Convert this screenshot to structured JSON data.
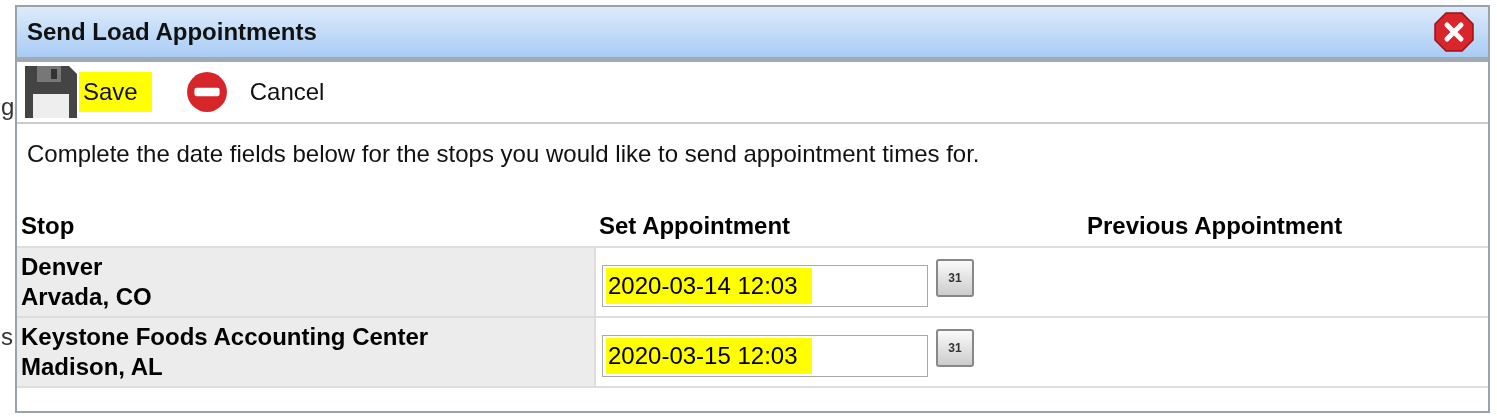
{
  "background": {
    "fragments": [
      "g",
      "s"
    ]
  },
  "dialog": {
    "title": "Send Load Appointments",
    "toolbar": [
      {
        "kind": "save",
        "label": "Save",
        "highlighted": true
      },
      {
        "kind": "cancel",
        "label": "Cancel",
        "highlighted": false
      }
    ],
    "instructions": "Complete the date fields below for the stops you would like to send appointment times for.",
    "table": {
      "columns": [
        "Stop",
        "Set Appointment",
        "Previous Appointment"
      ],
      "rows": [
        {
          "stop_name": "Denver",
          "stop_location": "Arvada, CO",
          "appointment": "2020-03-14 12:03",
          "highlighted": true,
          "calendar_label": "31"
        },
        {
          "stop_name": "Keystone Foods Accounting Center",
          "stop_location": "Madison, AL",
          "appointment": "2020-03-15 12:03",
          "highlighted": true,
          "calendar_label": "31"
        }
      ]
    }
  }
}
